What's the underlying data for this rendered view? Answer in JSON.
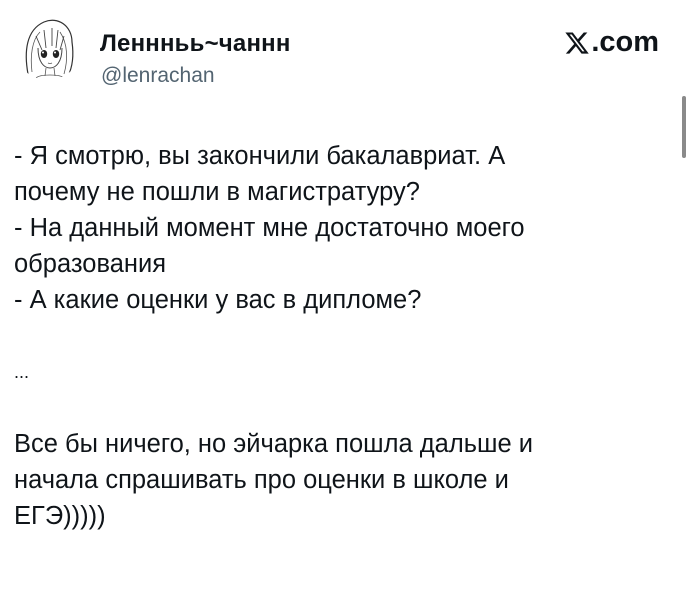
{
  "author": {
    "display_name": "Леннньь~чаннн",
    "handle": "@lenrachan",
    "avatar_icon": "anime-girl-sketch-avatar"
  },
  "brand": {
    "text": ".com",
    "icon": "x-logo-icon"
  },
  "tweet": {
    "lines": [
      "- Я смотрю, вы закончили бакалавриат. А",
      "почему не пошли в магистратуру?",
      "- На данный момент мне достаточно моего",
      "образования",
      "- А какие оценки у вас в дипломе?",
      "...",
      "Все бы ничего, но эйчарка пошла дальше и",
      "начала спрашивать про оценки в школе и",
      "ЕГЭ)))))"
    ]
  },
  "colors": {
    "text": "#0f1419",
    "secondary": "#536471",
    "background": "#ffffff"
  }
}
